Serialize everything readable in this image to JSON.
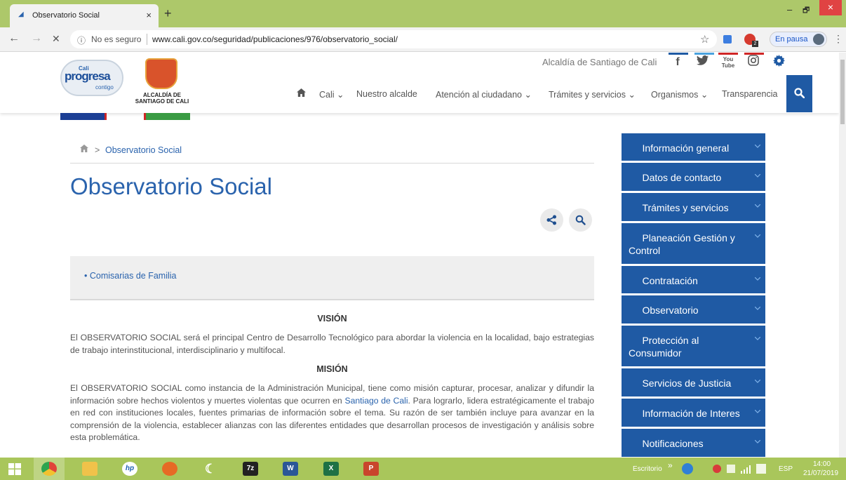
{
  "browser": {
    "tab_title": "Observatorio Social",
    "tab_close": "×",
    "new_tab": "+",
    "window_min": "–",
    "window_max": "🗗",
    "window_close": "×",
    "back": "←",
    "forward": "→",
    "stop": "✕",
    "security_icon": "ⓘ",
    "security_text": "No es seguro",
    "url": "www.cali.gov.co/seguridad/publicaciones/976/observatorio_social/",
    "star": "☆",
    "profile_label": "En pausa",
    "menu": "⋮",
    "ext_badge": "2"
  },
  "site": {
    "logo_cali": "Cali",
    "logo_progresa": "progresa",
    "logo_contigo": "contigo",
    "logo_alcaldia_1": "ALCALDÍA DE",
    "logo_alcaldia_2": "SANTIAGO DE CALI",
    "top_label": "Alcaldía de Santiago de Cali",
    "social": [
      "f",
      "t",
      "You Tube",
      "ig",
      "settings"
    ],
    "nav": [
      {
        "label": "Cali",
        "has_menu": true
      },
      {
        "label": "Nuestro alcalde",
        "has_menu": false
      },
      {
        "label": "Atención al ciudadano",
        "has_menu": true
      },
      {
        "label": "Trámites y servicios",
        "has_menu": true
      },
      {
        "label": "Organismos",
        "has_menu": true
      },
      {
        "label": "Transparencia",
        "has_menu": false
      }
    ],
    "chevron": "⌄",
    "home_icon": "⌂"
  },
  "content": {
    "breadcrumb_sep": ">",
    "breadcrumb_link": "Observatorio Social",
    "title": "Observatorio Social",
    "list_items": [
      "Comisarias de Familia"
    ],
    "vision_heading": "VISIÓN",
    "vision_text": "El OBSERVATORIO SOCIAL será el principal Centro de Desarrollo Tecnológico para abordar la violencia en la localidad, bajo estrategias de trabajo interinstitucional, interdisciplinario y multifocal.",
    "mision_heading": "MISIÓN",
    "mision_text_1": "El OBSERVATORIO SOCIAL como instancia de la Administración Municipal, tiene como misión capturar, procesar, analizar y difundir la información sobre hechos violentos y muertes violentas que ocurren en ",
    "mision_link": "Santiago de Cali",
    "mision_text_2": ". Para lograrlo, lidera estratégicamente el trabajo en red con instituciones locales, fuentes primarias de información sobre el tema. Su razón de ser también incluye para avanzar en la comprensión de la violencia, establecer alianzas con las diferentes entidades que desarrollan procesos de investigación y análisis sobre esta problemática."
  },
  "sidebar": {
    "items": [
      {
        "label": "Información general"
      },
      {
        "label": "Datos de contacto"
      },
      {
        "label": "Trámites y servicios"
      },
      {
        "label": "Planeación Gestión y Control"
      },
      {
        "label": "Contratación"
      },
      {
        "label": "Observatorio"
      },
      {
        "label": "Protección al Consumidor"
      },
      {
        "label": "Servicios de Justicia"
      },
      {
        "label": "Información de Interes"
      },
      {
        "label": "Notificaciones"
      }
    ]
  },
  "taskbar": {
    "escritorio": "Escritorio",
    "chevrons": "»",
    "lang": "ESP",
    "time": "14:00",
    "date": "21/07/2019",
    "apps": [
      "7z",
      "W",
      "X",
      "P"
    ]
  },
  "colors": {
    "accent": "#1f5aa4",
    "link": "#2a63ad",
    "chrome_green": "#adc86a"
  }
}
